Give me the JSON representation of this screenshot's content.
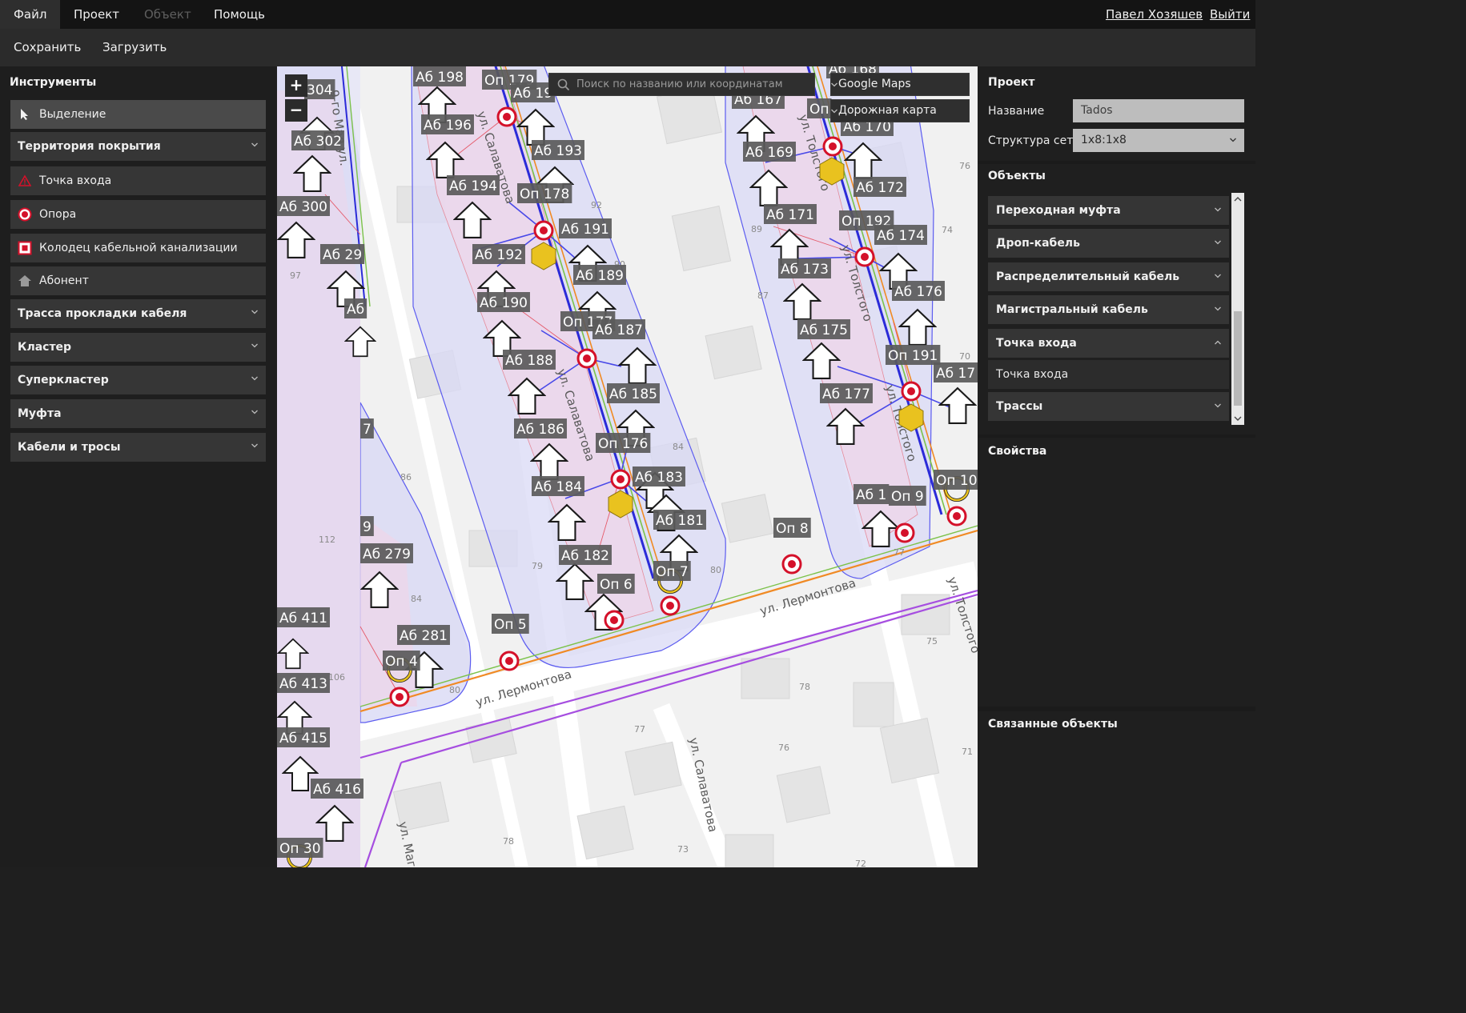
{
  "menu": {
    "items": [
      {
        "label": "Файл",
        "state": "active"
      },
      {
        "label": "Проект",
        "state": "normal"
      },
      {
        "label": "Объект",
        "state": "disabled"
      },
      {
        "label": "Помощь",
        "state": "normal"
      }
    ],
    "user_name": "Павел Хозяшев",
    "logout": "Выйти"
  },
  "toolbar": {
    "save": "Сохранить",
    "load": "Загрузить"
  },
  "tools": {
    "title": "Инструменты",
    "items": [
      {
        "label": "Выделение",
        "icon": "cursor-icon",
        "selected": true
      },
      {
        "label": "Территория покрытия",
        "group": true
      },
      {
        "label": "Точка входа",
        "icon": "warning-triangle-icon"
      },
      {
        "label": "Опора",
        "icon": "pole-circle-icon"
      },
      {
        "label": "Колодец кабельной канализации",
        "icon": "manhole-square-icon"
      },
      {
        "label": "Абонент",
        "icon": "house-icon"
      },
      {
        "label": "Трасса прокладки кабеля",
        "group": true
      },
      {
        "label": "Кластер",
        "group": true
      },
      {
        "label": "Суперкластер",
        "group": true
      },
      {
        "label": "Муфта",
        "group": true
      },
      {
        "label": "Кабели и тросы",
        "group": true
      }
    ]
  },
  "map": {
    "zoom_in": "+",
    "zoom_out": "−",
    "search_placeholder": "Поиск по названию или координатам",
    "provider": "Google Maps",
    "map_type": "Дорожная карта",
    "colors": {
      "coverage_fill": "#d9d9f5",
      "coverage_stroke": "#5c5cf0",
      "pink_zone": "#ecd6ea",
      "pole": "#d4112a",
      "coupler": "#e9c21f",
      "orange_cable": "#f08a24",
      "green_cable": "#7bc24a",
      "purple_cable": "#a64ee0",
      "label_bg": "#5a5a5a"
    },
    "streets": [
      "ул. Салаватова",
      "ул. Салаватова",
      "ул. Салаватова",
      "ул. Толстого",
      "ул. Толстого",
      "ул. Толстого",
      "ул. Толстого",
      "ул. Лермонтова",
      "ул. Лермонтова",
      "9-го Мая ул.",
      "ул. Маго"
    ],
    "house_numbers": [
      "92",
      "90",
      "89",
      "87",
      "84",
      "80",
      "79",
      "112",
      "97",
      "86",
      "84",
      "106",
      "80",
      "76",
      "74",
      "70",
      "77",
      "75",
      "78",
      "77",
      "76",
      "78",
      "73",
      "72",
      "71"
    ],
    "labels": [
      "Аб 198",
      "Оп 179",
      "Аб 19",
      "Аб 196",
      "Аб 193",
      "304",
      "Аб 302",
      "Аб 194",
      "Оп 178",
      "Аб 300",
      "Аб 191",
      "Аб 192",
      "Аб 189",
      "Аб 29",
      "Аб 190",
      "Оп 177",
      "Аб 187",
      "Аб 188",
      "Аб 185",
      "Аб 186",
      "Оп 176",
      "Аб 184",
      "Аб 183",
      "Аб 181",
      "Аб 182",
      "Оп 6",
      "Оп 7",
      "Оп 5",
      "Аб 281",
      "Оп 4",
      "Аб 279",
      "Аб 411",
      "Аб 413",
      "Аб 415",
      "Аб 416",
      "Оп 30",
      "Аб 168",
      "Аб 167",
      "Оп",
      "Аб 170",
      "Аб 169",
      "Аб 172",
      "Аб 171",
      "Оп 192",
      "Аб 174",
      "Аб 173",
      "Аб 176",
      "Аб 175",
      "Оп 191",
      "Аб 17",
      "Аб 177",
      "Оп 8",
      "Аб 1",
      "Оп 9",
      "Оп 10",
      "7",
      "9",
      "Аб"
    ]
  },
  "project": {
    "title": "Проект",
    "name_label": "Название",
    "name_value": "Tados",
    "structure_label": "Структура сети",
    "structure_value": "1x8:1x8"
  },
  "objects": {
    "title": "Объекты",
    "items": [
      {
        "label": "Переходная муфта",
        "expanded": false
      },
      {
        "label": "Дроп-кабель",
        "expanded": false
      },
      {
        "label": "Распределительный кабель",
        "expanded": false
      },
      {
        "label": "Магистральный кабель",
        "expanded": false
      },
      {
        "label": "Точка входа",
        "expanded": true
      }
    ],
    "sub_item": "Точка входа",
    "last_item": "Трассы"
  },
  "properties": {
    "title": "Свойства"
  },
  "linked": {
    "title": "Связанные объекты"
  }
}
